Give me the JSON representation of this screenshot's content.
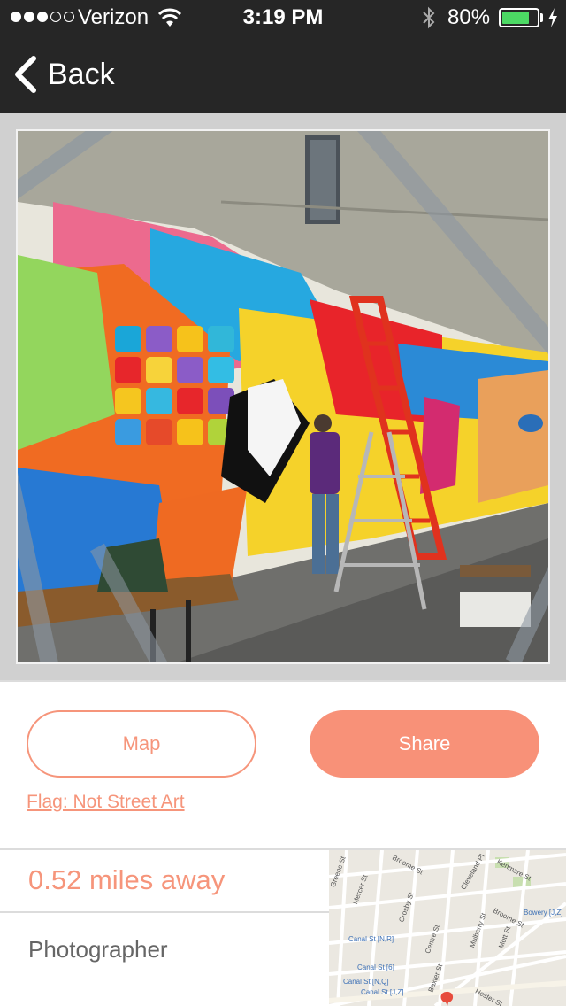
{
  "status_bar": {
    "carrier": "Verizon",
    "time": "3:19 PM",
    "battery_percent": "80%",
    "battery_level": 0.8,
    "signal_bars": 3
  },
  "nav": {
    "back_label": "Back"
  },
  "actions": {
    "map_label": "Map",
    "share_label": "Share",
    "flag_label": "Flag: Not Street Art"
  },
  "info": {
    "distance": "0.52 miles away",
    "photographer_label": "Photographer"
  },
  "map": {
    "streets": [
      "Broome St",
      "Kenmare St",
      "Cleveland Pl",
      "Broome St",
      "Mercer St",
      "Crosby St",
      "Greene St",
      "Centre St",
      "Mulberry St",
      "Mott St",
      "Baxter St",
      "Hester St"
    ],
    "stations": [
      "Canal St [N,R]",
      "Canal St [6]",
      "Canal St [N,Q]",
      "Canal St [J,Z]",
      "Bowery [J,Z]"
    ]
  },
  "colors": {
    "accent": "#f6957b",
    "share_bg": "#f89178",
    "nav_bg": "#262626",
    "battery": "#4cd964"
  }
}
